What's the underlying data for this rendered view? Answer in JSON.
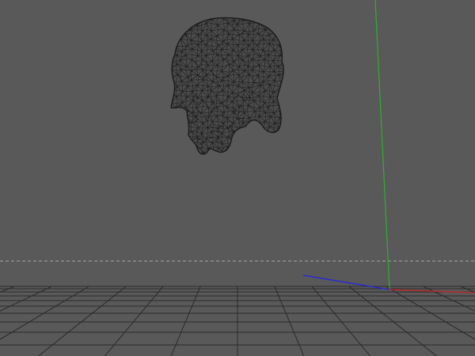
{
  "viewport": {
    "background_color": "#595959",
    "grid_color": "#2a2a2a",
    "horizon_dash_color": "#a8a8a8",
    "wireframe_color": "#1b1b1b"
  },
  "axes": {
    "x_color": "#b22d2d",
    "y_color": "#2db12d",
    "z_color": "#2b2bd2"
  },
  "model": {
    "type": "wireframe-mesh",
    "icon": "skull-wireframe"
  }
}
